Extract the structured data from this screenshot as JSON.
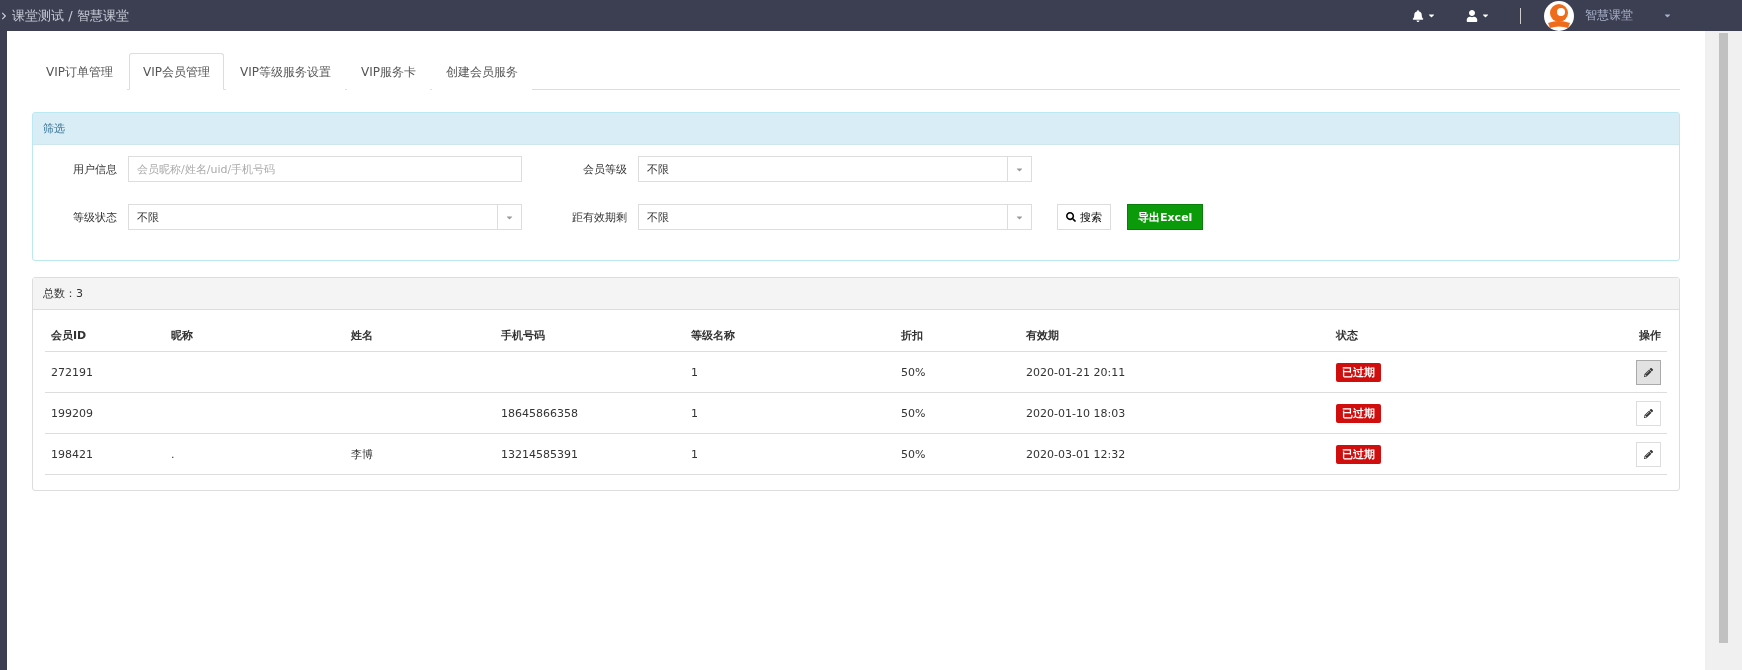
{
  "top_bar": {
    "breadcrumb": "课堂测试 / 智慧课堂",
    "account_name": "智慧课堂"
  },
  "tabs": [
    {
      "label": "VIP订单管理",
      "selected": false
    },
    {
      "label": "VIP会员管理",
      "selected": true
    },
    {
      "label": "VIP等级服务设置",
      "selected": false
    },
    {
      "label": "VIP服务卡",
      "selected": false
    },
    {
      "label": "创建会员服务",
      "selected": false
    }
  ],
  "filter": {
    "title": "筛选",
    "fields": [
      {
        "kind": "input",
        "label": "用户信息",
        "placeholder": "会员昵称/姓名/uid/手机号码"
      },
      {
        "kind": "select",
        "label": "会员等级",
        "value": "不限"
      },
      {
        "kind": "select",
        "label": "等级状态",
        "value": "不限"
      },
      {
        "kind": "select",
        "label": "距有效期剩",
        "value": "不限"
      }
    ],
    "search_button": "搜索",
    "export_button": "导出Excel"
  },
  "table": {
    "total": "总数：3",
    "columns": [
      "会员ID",
      "昵称",
      "姓名",
      "手机号码",
      "等级名称",
      "折扣",
      "有效期",
      "状态",
      "操作"
    ],
    "rows": [
      {
        "cells": [
          "272191",
          "",
          "",
          "",
          "1",
          "50%",
          "2020-01-21 20:11"
        ],
        "status": "已过期",
        "edit_active": true
      },
      {
        "cells": [
          "199209",
          "",
          "",
          "18645866358",
          "1",
          "50%",
          "2020-01-10 18:03"
        ],
        "status": "已过期",
        "edit_active": false
      },
      {
        "cells": [
          "198421",
          ".",
          "李博",
          "13214585391",
          "1",
          "50%",
          "2020-03-01 12:32"
        ],
        "status": "已过期",
        "edit_active": false
      }
    ]
  }
}
